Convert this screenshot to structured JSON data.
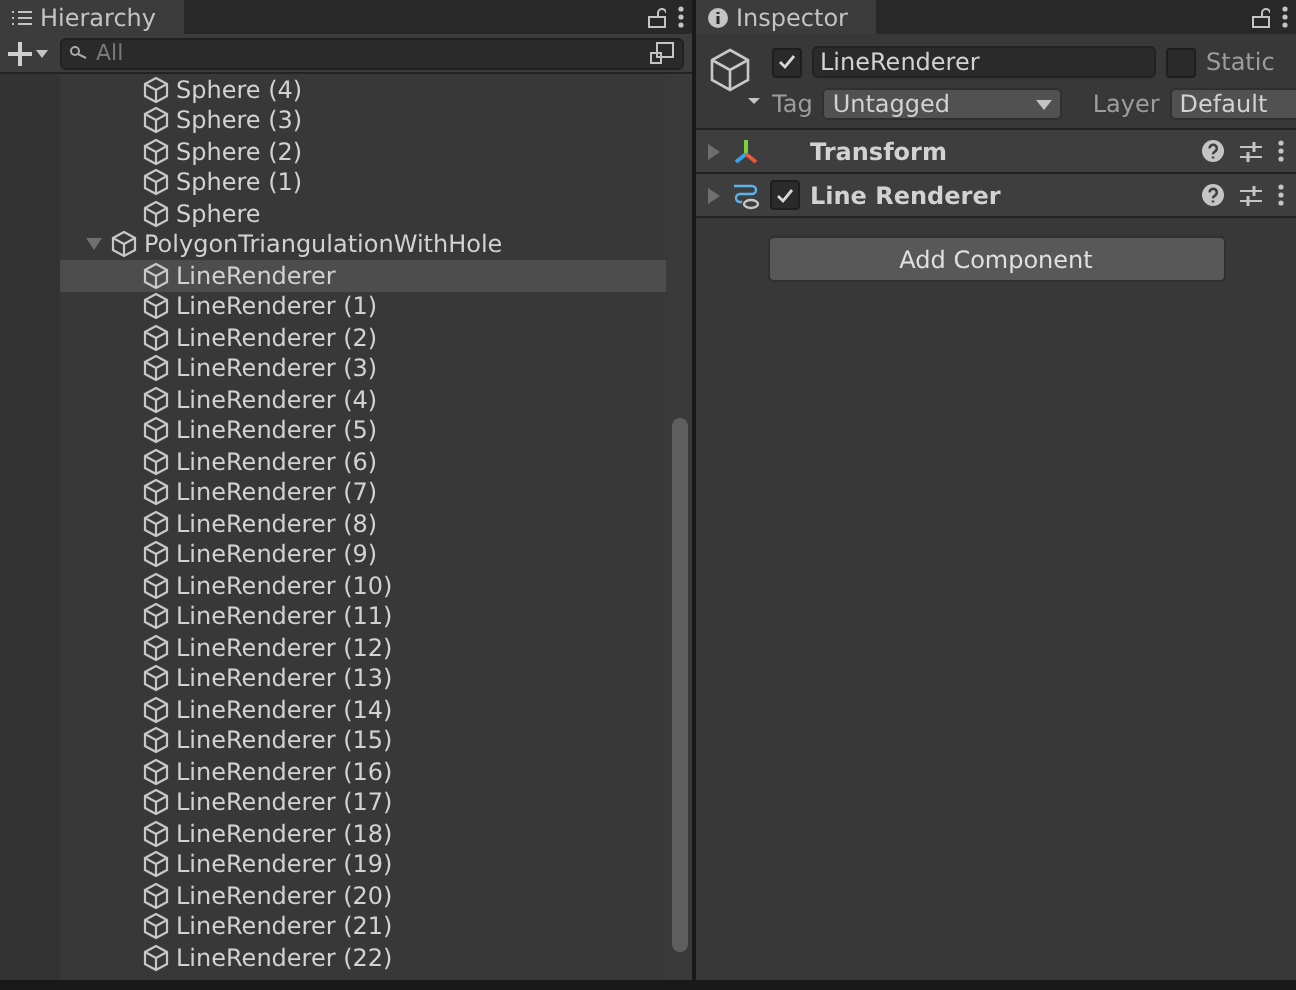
{
  "hierarchy": {
    "tab": "Hierarchy",
    "search": {
      "placeholder": "All"
    },
    "items": [
      {
        "children": [
          {
            "name": "Sphere (4)",
            "selected": false
          },
          {
            "name": "Sphere (3)",
            "selected": false
          },
          {
            "name": "Sphere (2)",
            "selected": false
          },
          {
            "name": "Sphere (1)",
            "selected": false
          },
          {
            "name": "Sphere",
            "selected": false
          }
        ]
      },
      {
        "name": "PolygonTriangulationWithHole",
        "selected": false,
        "expanded": true,
        "children": [
          {
            "name": "LineRenderer",
            "selected": true
          },
          {
            "name": "LineRenderer (1)",
            "selected": false
          },
          {
            "name": "LineRenderer (2)",
            "selected": false
          },
          {
            "name": "LineRenderer (3)",
            "selected": false
          },
          {
            "name": "LineRenderer (4)",
            "selected": false
          },
          {
            "name": "LineRenderer (5)",
            "selected": false
          },
          {
            "name": "LineRenderer (6)",
            "selected": false
          },
          {
            "name": "LineRenderer (7)",
            "selected": false
          },
          {
            "name": "LineRenderer (8)",
            "selected": false
          },
          {
            "name": "LineRenderer (9)",
            "selected": false
          },
          {
            "name": "LineRenderer (10)",
            "selected": false
          },
          {
            "name": "LineRenderer (11)",
            "selected": false
          },
          {
            "name": "LineRenderer (12)",
            "selected": false
          },
          {
            "name": "LineRenderer (13)",
            "selected": false
          },
          {
            "name": "LineRenderer (14)",
            "selected": false
          },
          {
            "name": "LineRenderer (15)",
            "selected": false
          },
          {
            "name": "LineRenderer (16)",
            "selected": false
          },
          {
            "name": "LineRenderer (17)",
            "selected": false
          },
          {
            "name": "LineRenderer (18)",
            "selected": false
          },
          {
            "name": "LineRenderer (19)",
            "selected": false
          },
          {
            "name": "LineRenderer (20)",
            "selected": false
          },
          {
            "name": "LineRenderer (21)",
            "selected": false
          },
          {
            "name": "LineRenderer (22)",
            "selected": false
          }
        ]
      }
    ]
  },
  "inspector": {
    "tab": "Inspector",
    "object": {
      "active": true,
      "name": "LineRenderer",
      "static_label": "Static",
      "static": false,
      "tag_label": "Tag",
      "tag": "Untagged",
      "layer_label": "Layer",
      "layer": "Default"
    },
    "components": [
      {
        "name": "Transform",
        "kind": "transform",
        "expanded": false
      },
      {
        "name": "Line Renderer",
        "kind": "line",
        "expanded": false,
        "enabled": true
      }
    ],
    "add_button": "Add Component"
  }
}
